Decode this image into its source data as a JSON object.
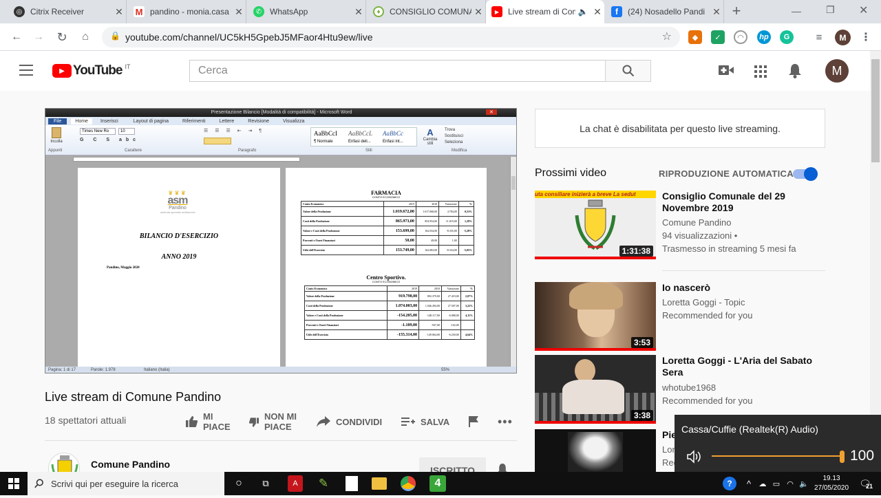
{
  "browser": {
    "tabs": [
      {
        "label": "Citrix Receiver",
        "icon": "citrix-icon",
        "color": "#333333"
      },
      {
        "label": "pandino - monia.casa",
        "icon": "gmail-icon",
        "color": "#d93025"
      },
      {
        "label": "WhatsApp",
        "icon": "whatsapp-icon",
        "color": "#25d366"
      },
      {
        "label": "CONSIGLIO COMUNALE",
        "icon": "comune-crest-icon",
        "color": "#7cb342"
      },
      {
        "label": "Live stream di Comune",
        "icon": "youtube-icon",
        "color": "#ff0000"
      },
      {
        "label": "(24) Nosadello Pandi",
        "icon": "facebook-icon",
        "color": "#1877f2"
      }
    ],
    "new_tab": "+",
    "url": "youtube.com/channel/UC5kH5GpebJ5MFaor4Htu9ew/live",
    "profile_initial": "M"
  },
  "youtube": {
    "logo_text": "YouTube",
    "logo_region": "IT",
    "search_placeholder": "Cerca",
    "avatar_initial": "M"
  },
  "player": {
    "word_title": "Presentazione Bilancio [Modalità di compatibilità] - Microsoft Word",
    "ribbon_tabs": [
      "File",
      "Home",
      "Inserisci",
      "Layout di pagina",
      "Riferimenti",
      "Lettere",
      "Revisione",
      "Visualizza"
    ],
    "font_name": "Times New Ro",
    "font_size": "10",
    "styles": [
      "AaBbCcI",
      "AaBbCcL",
      "AaBbCc"
    ],
    "style_names": [
      "¶ Normale",
      "Enfasi deli...",
      "Enfasi int..."
    ],
    "group_labels": [
      "Appunti",
      "Carattere",
      "Paragrafo",
      "Stili",
      "Modifica"
    ],
    "change_styles": "Cambia stili",
    "modify_items": [
      "Trova",
      "Sostituisci",
      "Seleziona"
    ],
    "page1": {
      "logo": "asm",
      "logo_city": "Pandino",
      "logo_sub": "azienda speciale multiservizi",
      "title": "BILANCIO D'ESERCIZIO",
      "year": "ANNO 2019",
      "place_date": "Pandino, Maggio 2020"
    },
    "page2": {
      "t1": "FARMACIA",
      "t1sub": "CONTO ECONOMICO",
      "t1_rows": [
        [
          "Conto Economico",
          "2019",
          "2018",
          "Variazione",
          "%"
        ],
        [
          "Valore della Produzione",
          "1.019.672,00",
          "1.017.068,00",
          "4.784,00",
          "0,53%"
        ],
        [
          "Costi della Produzione",
          "865.973,00",
          "854.954,00",
          "11.019,00",
          "1,29%"
        ],
        [
          "Valore e Costi della Produzione",
          "153.699,00",
          "162.034,00",
          "-8.335,00",
          "-5,28%"
        ],
        [
          "Proventi e Oneri Finanziari",
          "50,00",
          "49,00",
          "1,00",
          ""
        ],
        [
          "Utile dell'Esercizio",
          "153.749,00",
          "162.083,00",
          "-8.334,00",
          "-5,05%"
        ]
      ],
      "t2": "Centro Sportivo.",
      "t2sub": "CONTO ECONOMICO",
      "t2_rows": [
        [
          "Conto Economico",
          "2019",
          "2018",
          "Variazione",
          "%"
        ],
        [
          "Valore della Produzione",
          "919.798,00",
          "892.379,00",
          "27.419,00",
          "2,07%"
        ],
        [
          "Costi della Produzione",
          "1.074.003,00",
          "1.046.494,00",
          "27.507,00",
          "3,22%"
        ],
        [
          "Valore e Costi della Produzione",
          "-154.205,00",
          "-148.117,00",
          "-6.088,00",
          "4,11%"
        ],
        [
          "Proventi e Oneri Finanziari",
          "-1.109,00",
          "-947,00",
          "-162,00",
          ""
        ],
        [
          "Utile dell'Esercizio",
          "-155.314,00",
          "-149.064,00",
          "-6.250,00",
          "4,64%"
        ]
      ]
    },
    "status_page": "Pagina: 1 di 17",
    "status_words": "Parole: 1.978",
    "status_lang": "Italiano (Italia)",
    "zoom": "55%"
  },
  "video": {
    "title": "Live stream di Comune Pandino",
    "viewers": "18 spettatori attuali",
    "like_label": "MI PIACE",
    "dislike_label": "NON MI PIACE",
    "share_label": "CONDIVIDI",
    "save_label": "SALVA",
    "channel_name": "Comune Pandino",
    "subscribe_label": "ISCRITTO"
  },
  "sidebar": {
    "chat_notice": "La chat è disabilitata per questo live streaming.",
    "up_next": "Prossimi video",
    "autoplay": "RIPRODUZIONE AUTOMATICA",
    "autoplay_on": true,
    "items": [
      {
        "title": "Consiglio Comunale del 29 Novembre 2019",
        "channel": "Comune Pandino",
        "meta1": "94 visualizzazioni •",
        "meta2": "Trasmesso in streaming 5 mesi fa",
        "duration": "1:31:38",
        "banner": "uta consiliare inizierà a breve      La sedut"
      },
      {
        "title": "Io nascerò",
        "channel": "Loretta Goggi - Topic",
        "meta1": "Recommended for you",
        "meta2": "",
        "duration": "3:53",
        "banner": ""
      },
      {
        "title": "Loretta Goggi - L'Aria del Sabato Sera",
        "channel": "whotube1968",
        "meta1": "Recommended for you",
        "meta2": "",
        "duration": "3:38",
        "banner": ""
      },
      {
        "title": "Pie",
        "channel": "Lor",
        "meta1": "Rec",
        "meta2": "",
        "duration": "",
        "banner": ""
      }
    ]
  },
  "volume": {
    "device": "Cassa/Cuffie (Realtek(R) Audio)",
    "level": 100,
    "level_text": "100"
  },
  "taskbar": {
    "search_placeholder": "Scrivi qui per eseguire la ricerca",
    "time": "19.13",
    "date": "27/05/2020",
    "notifications": "21"
  }
}
